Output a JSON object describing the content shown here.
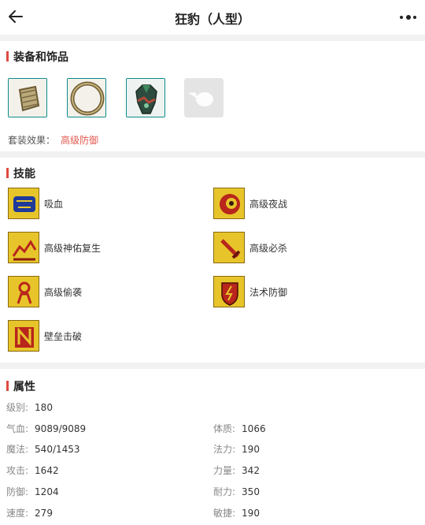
{
  "header": {
    "title": "狂豹（人型）"
  },
  "equipment": {
    "title": "装备和饰品",
    "items": [
      {
        "icon": "bracelet-icon"
      },
      {
        "icon": "ring-icon"
      },
      {
        "icon": "armor-icon"
      },
      {
        "icon": "empty-slot-icon"
      }
    ],
    "set_label": "套装效果：",
    "set_value": "高级防御"
  },
  "skills": {
    "title": "技能",
    "items": [
      {
        "name": "吸血",
        "icon": "blood-drain-icon"
      },
      {
        "name": "高级夜战",
        "icon": "night-combat-icon"
      },
      {
        "name": "高级神佑复生",
        "icon": "divine-revive-icon"
      },
      {
        "name": "高级必杀",
        "icon": "critical-strike-icon"
      },
      {
        "name": "高级偷袭",
        "icon": "sneak-attack-icon"
      },
      {
        "name": "法术防御",
        "icon": "magic-defense-icon"
      },
      {
        "name": "壁垒击破",
        "icon": "rampart-break-icon"
      }
    ]
  },
  "attributes": {
    "title": "属性",
    "rows": [
      {
        "left": {
          "label": "级别:",
          "value": "180"
        }
      },
      {
        "left": {
          "label": "气血:",
          "value": "9089/9089"
        },
        "right": {
          "label": "体质:",
          "value": "1066"
        }
      },
      {
        "left": {
          "label": "魔法:",
          "value": "540/1453"
        },
        "right": {
          "label": "法力:",
          "value": "190"
        }
      },
      {
        "left": {
          "label": "攻击:",
          "value": "1642"
        },
        "right": {
          "label": "力量:",
          "value": "342"
        }
      },
      {
        "left": {
          "label": "防御:",
          "value": "1204"
        },
        "right": {
          "label": "耐力:",
          "value": "350"
        }
      },
      {
        "left": {
          "label": "速度:",
          "value": "279"
        },
        "right": {
          "label": "敏捷:",
          "value": "190"
        }
      }
    ]
  },
  "colors": {
    "accent": "#e04a3f",
    "set_value": "#e25a4f",
    "equip_border": "#0c8b8b"
  }
}
